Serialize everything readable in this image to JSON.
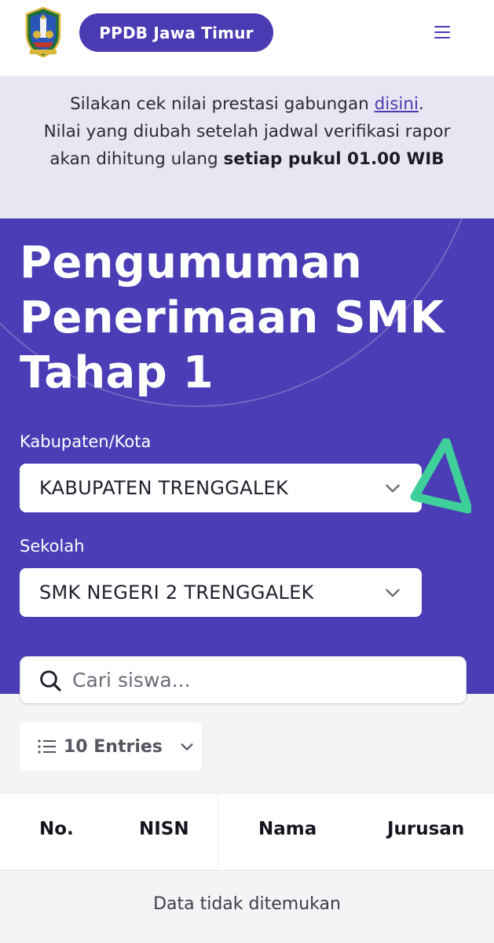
{
  "header": {
    "brand": "PPDB Jawa Timur",
    "logo_icon": "east-java-emblem-icon",
    "menu_icon": "hamburger-menu-icon"
  },
  "notice": {
    "text_before_link": "Silakan cek nilai prestasi gabungan ",
    "link_text": "disini",
    "text_after_link": ".",
    "line2": "Nilai yang diubah setelah jadwal verifikasi rapor akan dihitung ulang ",
    "bold_text": "setiap pukul 01.00 WIB"
  },
  "hero": {
    "title": "Pengumuman Penerimaan SMK Tahap 1",
    "kabupaten_label": "Kabupaten/Kota",
    "kabupaten_value": "KABUPATEN TRENGGALEK",
    "sekolah_label": "Sekolah",
    "sekolah_value": "SMK NEGERI 2 TRENGGALEK"
  },
  "search": {
    "placeholder": "Cari siswa..."
  },
  "entries": {
    "label": "10 Entries"
  },
  "table": {
    "columns": [
      "No.",
      "NISN",
      "Nama",
      "Jurusan"
    ],
    "rows": [],
    "empty_message": "Data tidak ditemukan"
  },
  "colors": {
    "brand": "#4b3bb3",
    "hero_bg": "#4a3db5",
    "notice_bg": "#e8e6f3",
    "accent_green": "#3ecf9a"
  }
}
